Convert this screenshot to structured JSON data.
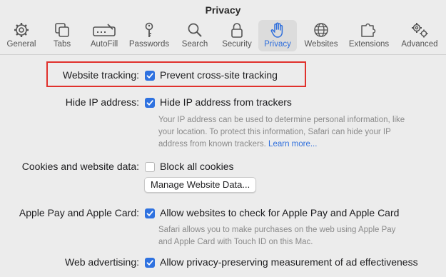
{
  "window": {
    "title": "Privacy"
  },
  "toolbar": {
    "items": [
      {
        "label": "General",
        "icon": "gear-icon"
      },
      {
        "label": "Tabs",
        "icon": "tabs-icon"
      },
      {
        "label": "AutoFill",
        "icon": "autofill-icon"
      },
      {
        "label": "Passwords",
        "icon": "key-icon"
      },
      {
        "label": "Search",
        "icon": "search-icon"
      },
      {
        "label": "Security",
        "icon": "lock-icon"
      },
      {
        "label": "Privacy",
        "icon": "hand-icon",
        "active": true
      },
      {
        "label": "Websites",
        "icon": "globe-icon"
      },
      {
        "label": "Extensions",
        "icon": "puzzle-icon"
      },
      {
        "label": "Advanced",
        "icon": "gears-icon"
      }
    ]
  },
  "settings": {
    "website_tracking": {
      "label": "Website tracking:",
      "option": "Prevent cross-site tracking",
      "checked": true
    },
    "hide_ip": {
      "label": "Hide IP address:",
      "option": "Hide IP address from trackers",
      "checked": true,
      "desc_1": "Your IP address can be used to determine personal information, like",
      "desc_2": "your location. To protect this information, Safari can hide your IP",
      "desc_3": "address from known trackers.",
      "link": "Learn more..."
    },
    "cookies": {
      "label": "Cookies and website data:",
      "option": "Block all cookies",
      "checked": false,
      "button": "Manage Website Data..."
    },
    "apple_pay": {
      "label": "Apple Pay and Apple Card:",
      "option": "Allow websites to check for Apple Pay and Apple Card",
      "checked": true,
      "desc_1": "Safari allows you to make purchases on the web using Apple Pay",
      "desc_2": "and Apple Card with Touch ID on this Mac."
    },
    "web_advertising": {
      "label": "Web advertising:",
      "option": "Allow privacy-preserving measurement of ad effectiveness",
      "checked": true
    }
  },
  "colors": {
    "accent": "#2f72e0",
    "highlight": "#e0312c"
  }
}
